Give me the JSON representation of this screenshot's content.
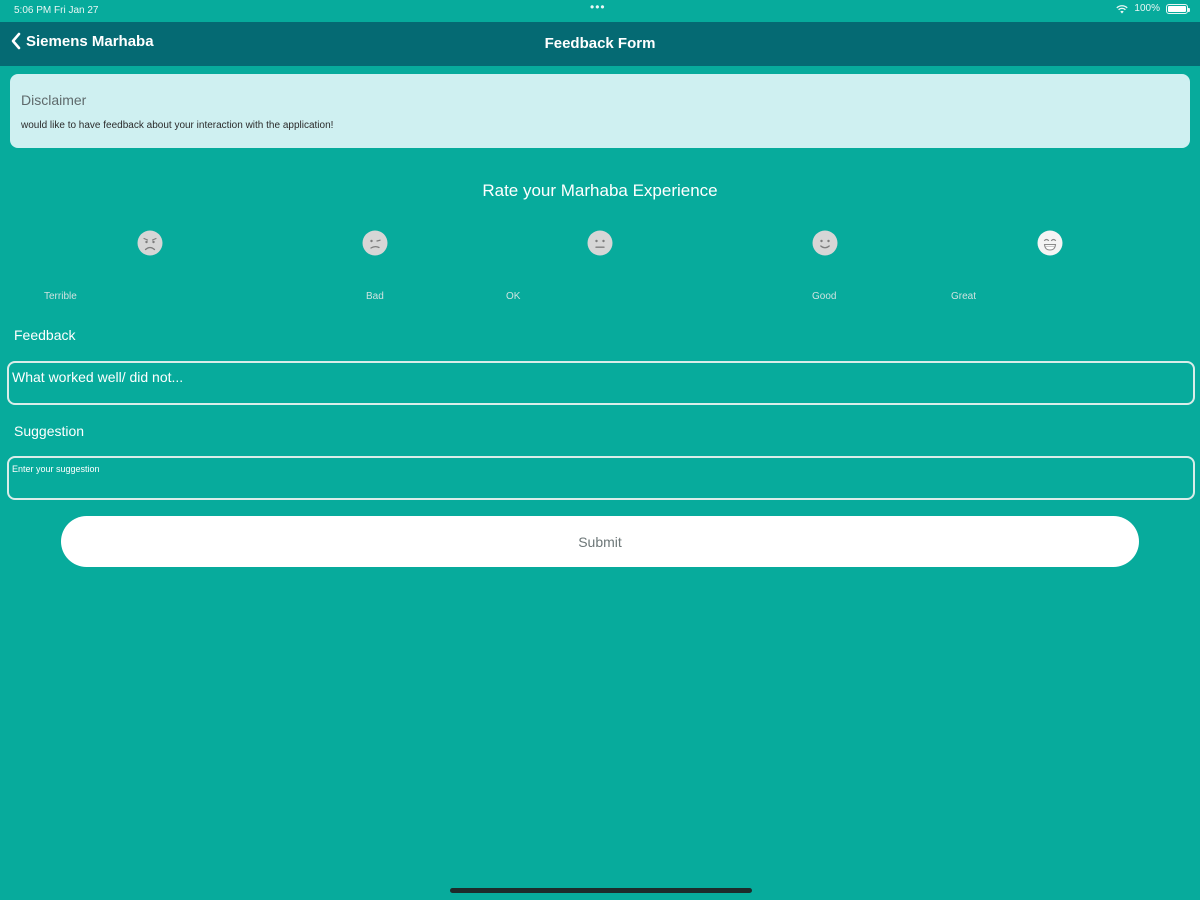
{
  "status_bar": {
    "time": "5:06 PM   Fri Jan 27",
    "dots": "•••",
    "battery": "100%",
    "battery_level": 1.0
  },
  "nav": {
    "back_label": "Siemens Marhaba",
    "title": "Feedback Form"
  },
  "disclaimer": {
    "title": "Disclaimer",
    "text": "would like to have feedback about your interaction with the application!"
  },
  "rating": {
    "title": "Rate your Marhaba Experience",
    "options": [
      {
        "label": "Terrible",
        "icon": "terrible-face-icon"
      },
      {
        "label": "Bad",
        "icon": "bad-face-icon"
      },
      {
        "label": "OK",
        "icon": "ok-face-icon"
      },
      {
        "label": "Good",
        "icon": "good-face-icon"
      },
      {
        "label": "Great",
        "icon": "great-face-icon"
      }
    ]
  },
  "feedback": {
    "label": "Feedback",
    "placeholder": "What worked well/ did not..."
  },
  "suggestion": {
    "label": "Suggestion",
    "placeholder": "Enter your suggestion"
  },
  "submit_label": "Submit",
  "colors": {
    "background": "#07ab9c",
    "nav_bar": "#056a73",
    "disclaimer_card": "#cff0f1"
  }
}
